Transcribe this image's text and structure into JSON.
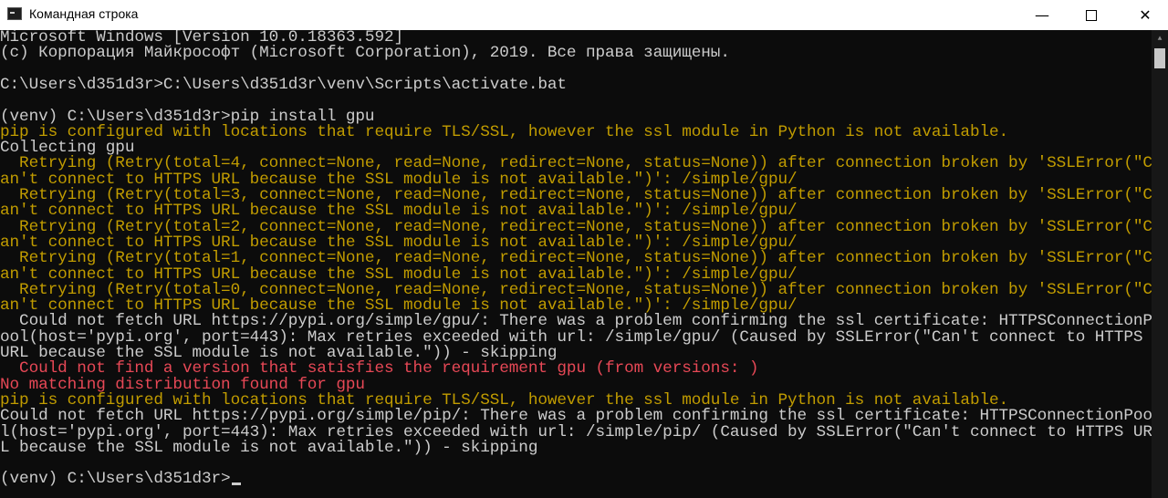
{
  "window": {
    "title": "Командная строка",
    "icon": "cmd-icon",
    "controls": {
      "minimize": "—",
      "maximize": "max-icon",
      "close": "✕"
    }
  },
  "colors": {
    "background": "#0c0c0c",
    "text": "#cccccc",
    "warning": "#c19c00",
    "error": "#e74856"
  },
  "console": {
    "lines": [
      {
        "text": "Microsoft Windows [Version 10.0.18363.592]",
        "color": "white"
      },
      {
        "text": "(c) Корпорация Майкрософт (Microsoft Corporation), 2019. Все права защищены.",
        "color": "white"
      },
      {
        "text": "",
        "color": "white"
      },
      {
        "text": "C:\\Users\\d351d3r>C:\\Users\\d351d3r\\venv\\Scripts\\activate.bat",
        "color": "white"
      },
      {
        "text": "",
        "color": "white"
      },
      {
        "text": "(venv) C:\\Users\\d351d3r>pip install gpu",
        "color": "white"
      },
      {
        "text": "pip is configured with locations that require TLS/SSL, however the ssl module in Python is not available.",
        "color": "yellow"
      },
      {
        "text": "Collecting gpu",
        "color": "white"
      },
      {
        "text": "  Retrying (Retry(total=4, connect=None, read=None, redirect=None, status=None)) after connection broken by 'SSLError(\"C",
        "color": "yellow"
      },
      {
        "text": "an't connect to HTTPS URL because the SSL module is not available.\")': /simple/gpu/",
        "color": "yellow"
      },
      {
        "text": "  Retrying (Retry(total=3, connect=None, read=None, redirect=None, status=None)) after connection broken by 'SSLError(\"C",
        "color": "yellow"
      },
      {
        "text": "an't connect to HTTPS URL because the SSL module is not available.\")': /simple/gpu/",
        "color": "yellow"
      },
      {
        "text": "  Retrying (Retry(total=2, connect=None, read=None, redirect=None, status=None)) after connection broken by 'SSLError(\"C",
        "color": "yellow"
      },
      {
        "text": "an't connect to HTTPS URL because the SSL module is not available.\")': /simple/gpu/",
        "color": "yellow"
      },
      {
        "text": "  Retrying (Retry(total=1, connect=None, read=None, redirect=None, status=None)) after connection broken by 'SSLError(\"C",
        "color": "yellow"
      },
      {
        "text": "an't connect to HTTPS URL because the SSL module is not available.\")': /simple/gpu/",
        "color": "yellow"
      },
      {
        "text": "  Retrying (Retry(total=0, connect=None, read=None, redirect=None, status=None)) after connection broken by 'SSLError(\"C",
        "color": "yellow"
      },
      {
        "text": "an't connect to HTTPS URL because the SSL module is not available.\")': /simple/gpu/",
        "color": "yellow"
      },
      {
        "text": "  Could not fetch URL https://pypi.org/simple/gpu/: There was a problem confirming the ssl certificate: HTTPSConnectionP",
        "color": "white"
      },
      {
        "text": "ool(host='pypi.org', port=443): Max retries exceeded with url: /simple/gpu/ (Caused by SSLError(\"Can't connect to HTTPS",
        "color": "white"
      },
      {
        "text": "URL because the SSL module is not available.\")) - skipping",
        "color": "white"
      },
      {
        "text": "  Could not find a version that satisfies the requirement gpu (from versions: )",
        "color": "red"
      },
      {
        "text": "No matching distribution found for gpu",
        "color": "red"
      },
      {
        "text": "pip is configured with locations that require TLS/SSL, however the ssl module in Python is not available.",
        "color": "yellow"
      },
      {
        "text": "Could not fetch URL https://pypi.org/simple/pip/: There was a problem confirming the ssl certificate: HTTPSConnectionPoo",
        "color": "white"
      },
      {
        "text": "l(host='pypi.org', port=443): Max retries exceeded with url: /simple/pip/ (Caused by SSLError(\"Can't connect to HTTPS UR",
        "color": "white"
      },
      {
        "text": "L because the SSL module is not available.\")) - skipping",
        "color": "white"
      },
      {
        "text": "",
        "color": "white"
      },
      {
        "text": "(venv) C:\\Users\\d351d3r>",
        "color": "white",
        "cursor": true
      }
    ]
  },
  "scrollbar": {
    "up_arrow": "▲"
  }
}
